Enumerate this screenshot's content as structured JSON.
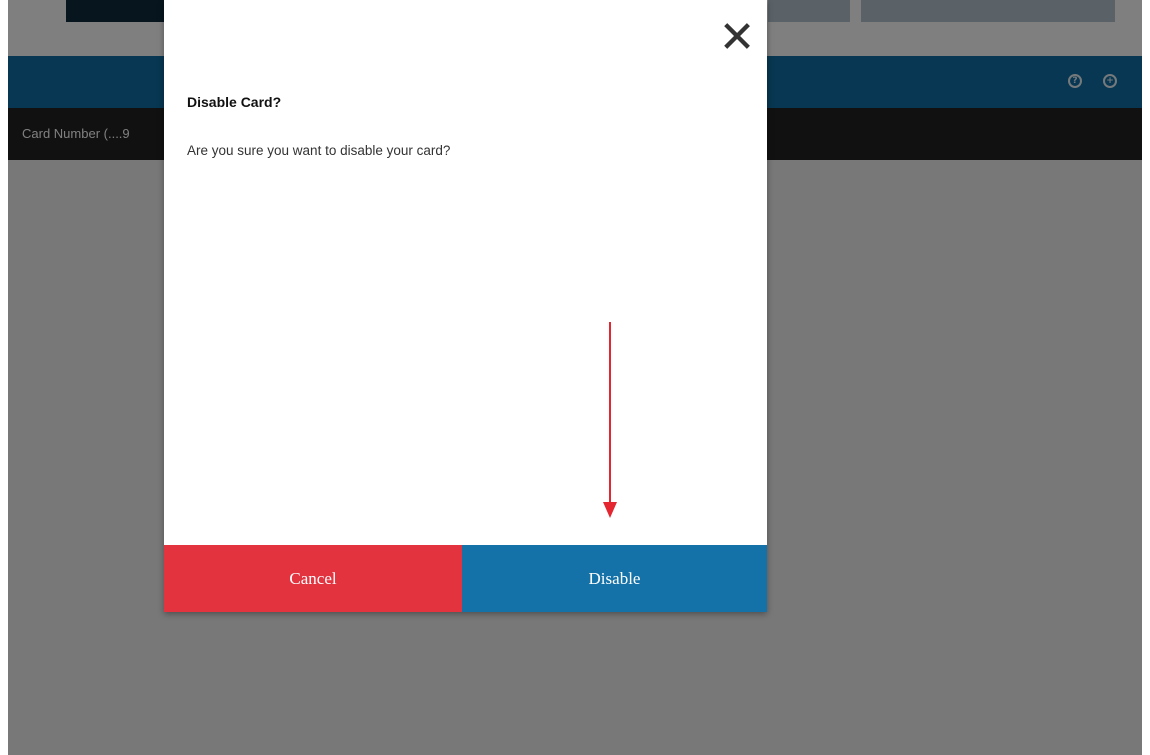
{
  "background": {
    "table_header": "Card Number (....9"
  },
  "dialog": {
    "title": "Disable Card?",
    "message": "Are you sure you want to disable your card?",
    "close_icon": "close-icon",
    "cancel_label": "Cancel",
    "disable_label": "Disable"
  },
  "colors": {
    "cancel": "#e2333f",
    "disable": "#1472a8",
    "nav": "#0f6fa5",
    "annotation_arrow": "#e3262f"
  }
}
